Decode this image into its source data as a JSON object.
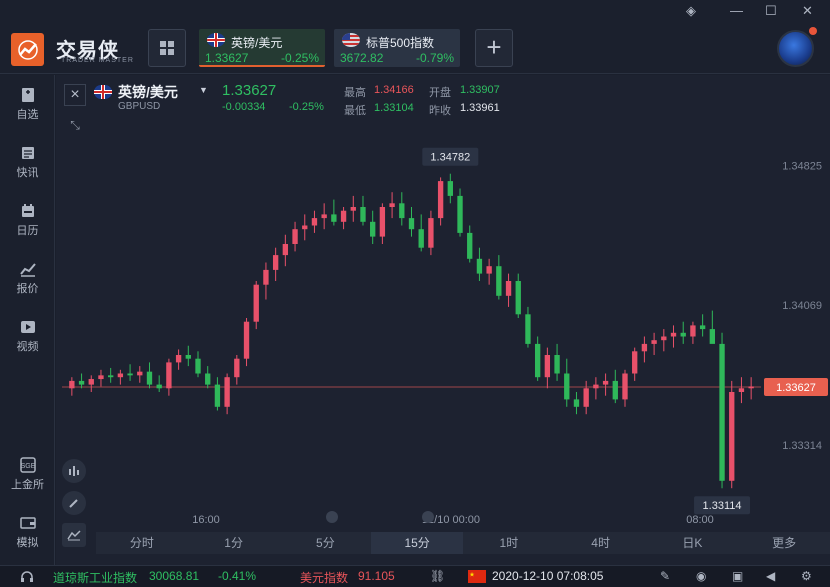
{
  "app": {
    "brand": "交易侠",
    "brand_sub": "TRADER MASTER"
  },
  "tabs": [
    {
      "name": "英镑/美元",
      "price": "1.33627",
      "change": "-0.25%"
    },
    {
      "name": "标普500指数",
      "price": "3672.82",
      "change": "-0.79%"
    }
  ],
  "sidebar": [
    {
      "label": "自选"
    },
    {
      "label": "快讯"
    },
    {
      "label": "日历"
    },
    {
      "label": "报价"
    },
    {
      "label": "视频"
    },
    {
      "label": "上金所"
    },
    {
      "label": "模拟"
    }
  ],
  "quote": {
    "symbol": "英镑/美元",
    "code": "GBPUSD",
    "last": "1.33627",
    "change": "-0.00334",
    "change_pct": "-0.25%",
    "high_label": "最高",
    "high": "1.34166",
    "low_label": "最低",
    "low": "1.33104",
    "open_label": "开盘",
    "open": "1.33907",
    "prev_label": "昨收",
    "prev": "1.33961"
  },
  "chart_data": {
    "type": "candlestick",
    "y_ticks": [
      "1.34825",
      "1.34069",
      "1.33314"
    ],
    "x_ticks": [
      "16:00",
      "12/10 00:00",
      "08:00"
    ],
    "current_price": "1.33627",
    "max_label": "1.34782",
    "min_label": "1.33114",
    "ylim": [
      1.33,
      1.35
    ],
    "candles": [
      [
        1.3362,
        1.3368,
        1.3358,
        1.3366
      ],
      [
        1.3366,
        1.337,
        1.3362,
        1.3364
      ],
      [
        1.3364,
        1.3369,
        1.336,
        1.3367
      ],
      [
        1.3367,
        1.3372,
        1.3363,
        1.3369
      ],
      [
        1.3369,
        1.3373,
        1.3365,
        1.3368
      ],
      [
        1.3368,
        1.3372,
        1.3364,
        1.337
      ],
      [
        1.337,
        1.3375,
        1.3366,
        1.3369
      ],
      [
        1.3369,
        1.3374,
        1.3365,
        1.3371
      ],
      [
        1.3371,
        1.3376,
        1.3362,
        1.3364
      ],
      [
        1.3364,
        1.3369,
        1.336,
        1.3362
      ],
      [
        1.3362,
        1.3378,
        1.3358,
        1.3376
      ],
      [
        1.3376,
        1.3383,
        1.3372,
        1.338
      ],
      [
        1.338,
        1.3385,
        1.3374,
        1.3378
      ],
      [
        1.3378,
        1.3382,
        1.3368,
        1.337
      ],
      [
        1.337,
        1.3374,
        1.3362,
        1.3364
      ],
      [
        1.3364,
        1.3368,
        1.335,
        1.3352
      ],
      [
        1.3352,
        1.337,
        1.3348,
        1.3368
      ],
      [
        1.3368,
        1.338,
        1.3364,
        1.3378
      ],
      [
        1.3378,
        1.34,
        1.3374,
        1.3398
      ],
      [
        1.3398,
        1.342,
        1.3394,
        1.3418
      ],
      [
        1.3418,
        1.343,
        1.341,
        1.3426
      ],
      [
        1.3426,
        1.3438,
        1.342,
        1.3434
      ],
      [
        1.3434,
        1.3445,
        1.3428,
        1.344
      ],
      [
        1.344,
        1.3452,
        1.3436,
        1.3448
      ],
      [
        1.3448,
        1.3456,
        1.3442,
        1.345
      ],
      [
        1.345,
        1.3458,
        1.3446,
        1.3454
      ],
      [
        1.3454,
        1.3462,
        1.3448,
        1.3456
      ],
      [
        1.3456,
        1.3464,
        1.345,
        1.3452
      ],
      [
        1.3452,
        1.346,
        1.3448,
        1.3458
      ],
      [
        1.3458,
        1.3466,
        1.3452,
        1.346
      ],
      [
        1.346,
        1.3466,
        1.345,
        1.3452
      ],
      [
        1.3452,
        1.3458,
        1.344,
        1.3444
      ],
      [
        1.3444,
        1.3462,
        1.344,
        1.346
      ],
      [
        1.346,
        1.3468,
        1.3454,
        1.3462
      ],
      [
        1.3462,
        1.3468,
        1.345,
        1.3454
      ],
      [
        1.3454,
        1.346,
        1.3444,
        1.3448
      ],
      [
        1.3448,
        1.3456,
        1.3436,
        1.3438
      ],
      [
        1.3438,
        1.3458,
        1.3434,
        1.3454
      ],
      [
        1.3454,
        1.3476,
        1.345,
        1.3474
      ],
      [
        1.3474,
        1.3478,
        1.3462,
        1.3466
      ],
      [
        1.3466,
        1.347,
        1.3444,
        1.3446
      ],
      [
        1.3446,
        1.345,
        1.343,
        1.3432
      ],
      [
        1.3432,
        1.3438,
        1.342,
        1.3424
      ],
      [
        1.3424,
        1.3432,
        1.3418,
        1.3428
      ],
      [
        1.3428,
        1.3434,
        1.341,
        1.3412
      ],
      [
        1.3412,
        1.3424,
        1.3406,
        1.342
      ],
      [
        1.342,
        1.3424,
        1.34,
        1.3402
      ],
      [
        1.3402,
        1.3406,
        1.3384,
        1.3386
      ],
      [
        1.3386,
        1.339,
        1.3366,
        1.3368
      ],
      [
        1.3368,
        1.3384,
        1.3362,
        1.338
      ],
      [
        1.338,
        1.3386,
        1.3366,
        1.337
      ],
      [
        1.337,
        1.3378,
        1.3352,
        1.3356
      ],
      [
        1.3356,
        1.336,
        1.3348,
        1.3352
      ],
      [
        1.3352,
        1.3366,
        1.3348,
        1.3362
      ],
      [
        1.3362,
        1.3368,
        1.3356,
        1.3364
      ],
      [
        1.3364,
        1.337,
        1.3358,
        1.3366
      ],
      [
        1.3366,
        1.3372,
        1.3354,
        1.3356
      ],
      [
        1.3356,
        1.3372,
        1.3352,
        1.337
      ],
      [
        1.337,
        1.3384,
        1.3366,
        1.3382
      ],
      [
        1.3382,
        1.339,
        1.3376,
        1.3386
      ],
      [
        1.3386,
        1.3392,
        1.338,
        1.3388
      ],
      [
        1.3388,
        1.3394,
        1.3382,
        1.339
      ],
      [
        1.339,
        1.3396,
        1.3384,
        1.3392
      ],
      [
        1.3392,
        1.3398,
        1.3386,
        1.339
      ],
      [
        1.339,
        1.3398,
        1.3386,
        1.3396
      ],
      [
        1.3396,
        1.3402,
        1.339,
        1.3394
      ],
      [
        1.3394,
        1.3404,
        1.3388,
        1.3386
      ],
      [
        1.3386,
        1.3392,
        1.3308,
        1.3312
      ],
      [
        1.3312,
        1.3366,
        1.3308,
        1.336
      ],
      [
        1.336,
        1.3368,
        1.3354,
        1.3362
      ],
      [
        1.3362,
        1.3368,
        1.3356,
        1.3363
      ]
    ]
  },
  "periods": [
    "分时",
    "1分",
    "5分",
    "15分",
    "1时",
    "4时",
    "日K",
    "更多"
  ],
  "active_period": "15分",
  "ticker": [
    {
      "name": "道琼斯工业指数",
      "value": "30068.81",
      "change": "-0.41%"
    },
    {
      "name": "美元指数",
      "value": "91.105"
    }
  ],
  "datetime": "2020-12-10 07:08:05"
}
